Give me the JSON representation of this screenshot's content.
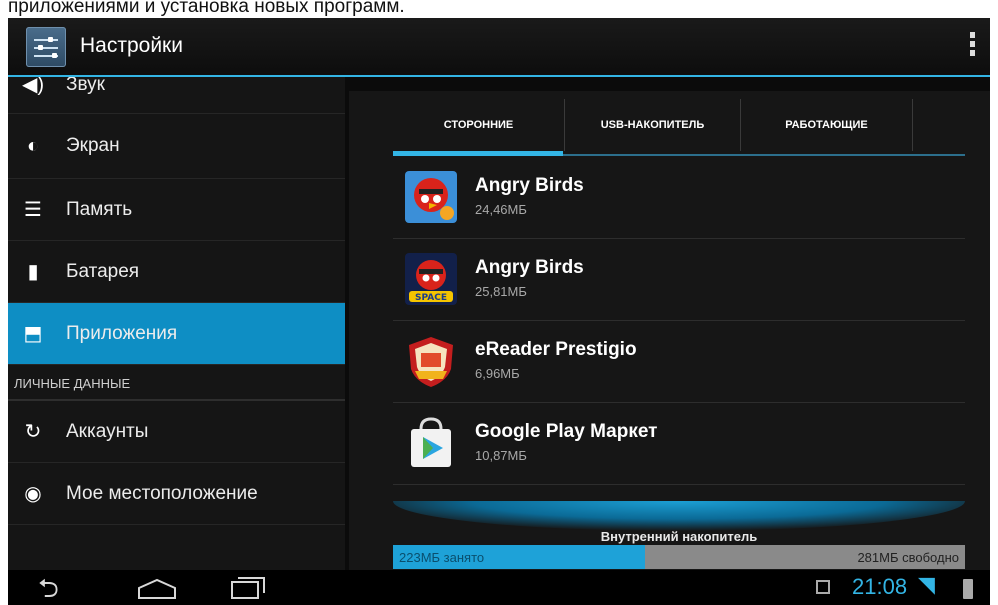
{
  "caption": "приложениями и установка новых программ.",
  "actionbar": {
    "title": "Настройки",
    "menu_icon": "overflow-menu-icon"
  },
  "sidebar": {
    "items_top": [
      {
        "label": "Звук",
        "icon": "volume-icon"
      },
      {
        "label": "Экран",
        "icon": "brightness-icon"
      },
      {
        "label": "Память",
        "icon": "storage-icon"
      },
      {
        "label": "Батарея",
        "icon": "battery-icon"
      },
      {
        "label": "Приложения",
        "icon": "apps-icon",
        "active": true
      }
    ],
    "section_header": "ЛИЧНЫЕ ДАННЫЕ",
    "items_bottom": [
      {
        "label": "Аккаунты",
        "icon": "sync-icon"
      },
      {
        "label": "Мое местоположение",
        "icon": "location-icon"
      }
    ]
  },
  "tabs": [
    {
      "label": "СТОРОННИЕ",
      "selected": true
    },
    {
      "label": "USB-НАКОПИТЕЛЬ",
      "selected": false
    },
    {
      "label": "РАБОТАЮЩИЕ",
      "selected": false
    }
  ],
  "apps": [
    {
      "name": "Angry Birds",
      "size": "24,46МБ",
      "icon": "angry-birds-rio-icon"
    },
    {
      "name": "Angry Birds",
      "size": "25,81МБ",
      "icon": "angry-birds-space-icon"
    },
    {
      "name": "eReader Prestigio",
      "size": "6,96МБ",
      "icon": "ereader-icon"
    },
    {
      "name": "Google Play Маркет",
      "size": "10,87МБ",
      "icon": "play-store-icon"
    }
  ],
  "storage": {
    "title": "Внутренний накопитель",
    "used_text": "223МБ занято",
    "free_text": "281МБ свободно",
    "used_fraction": 0.44,
    "accent_color": "#33b5e5"
  },
  "statusbar": {
    "time": "21:08",
    "icons": [
      "gallery-icon",
      "wifi-icon",
      "battery-icon"
    ]
  },
  "navbar": {
    "icons": [
      "back-icon",
      "home-icon",
      "recent-apps-icon"
    ]
  }
}
